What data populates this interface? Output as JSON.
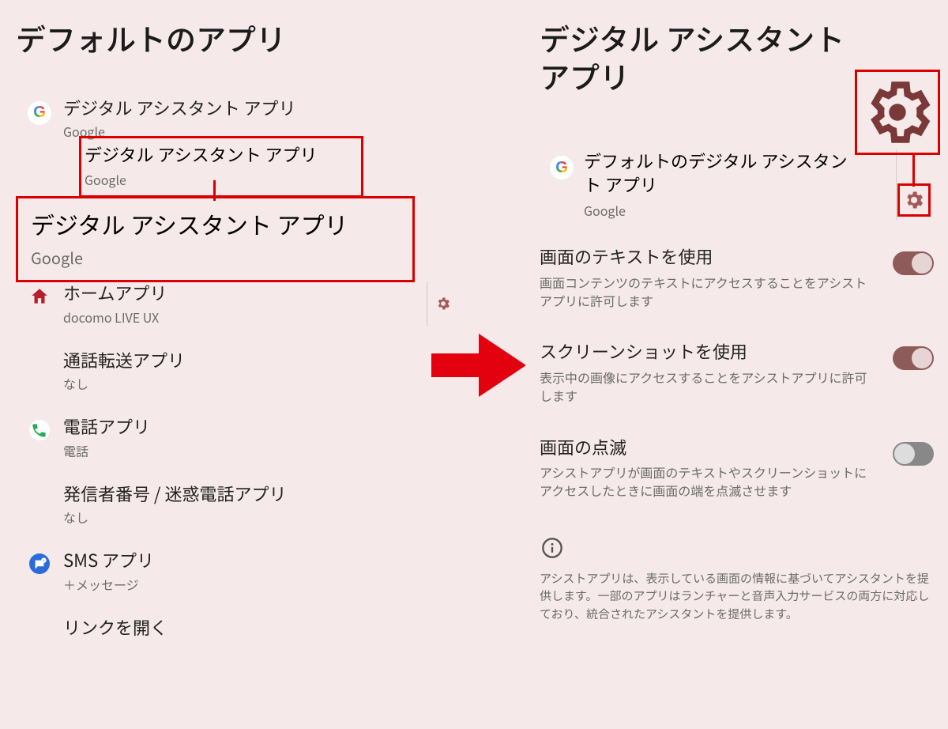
{
  "left": {
    "title": "デフォルトのアプリ",
    "highlight_small": {
      "label": "デジタル アシスタント アプリ",
      "sub": "Google"
    },
    "highlight_big": {
      "label": "デジタル アシスタント アプリ",
      "sub": "Google"
    },
    "items": {
      "digital_assistant": {
        "label": "デジタル アシスタント アプリ",
        "sub": "Google"
      },
      "home": {
        "label": "ホームアプリ",
        "sub": "docomo LIVE UX"
      },
      "call_forward": {
        "label": "通話転送アプリ",
        "sub": "なし"
      },
      "phone": {
        "label": "電話アプリ",
        "sub": "電話"
      },
      "caller_id": {
        "label": "発信者番号 / 迷惑電話アプリ",
        "sub": "なし"
      },
      "sms": {
        "label": "SMS アプリ",
        "sub": "＋メッセージ"
      },
      "open_links": {
        "label": "リンクを開く"
      }
    }
  },
  "right": {
    "title": "デジタル アシスタント アプリ",
    "default_app": {
      "label": "デフォルトのデジタル アシスタント アプリ",
      "sub": "Google"
    },
    "text_use": {
      "label": "画面のテキストを使用",
      "sub": "画面コンテンツのテキストにアクセスすることをアシストアプリに許可します",
      "on": true
    },
    "screenshot_use": {
      "label": "スクリーンショットを使用",
      "sub": "表示中の画像にアクセスすることをアシストアプリに許可します",
      "on": true
    },
    "flash": {
      "label": "画面の点滅",
      "sub": "アシストアプリが画面のテキストやスクリーンショットにアクセスしたときに画面の端を点滅させます",
      "on": false
    },
    "note": "アシストアプリは、表示している画面の情報に基づいてアシスタントを提供します。一部のアプリはランチャーと音声入力サービスの両方に対応しており、統合されたアシスタントを提供します。"
  }
}
